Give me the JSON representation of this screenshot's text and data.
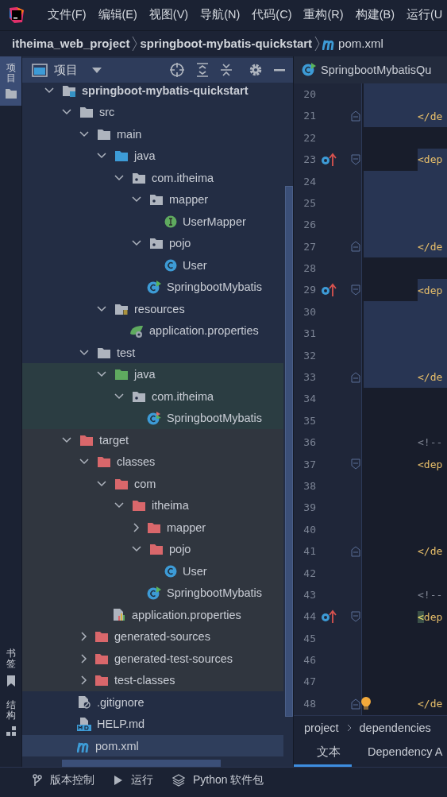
{
  "menu": [
    "文件(F)",
    "编辑(E)",
    "视图(V)",
    "导航(N)",
    "代码(C)",
    "重构(R)",
    "构建(B)",
    "运行(U"
  ],
  "breadcrumb": [
    {
      "label": "itheima_web_project",
      "kind": "folder"
    },
    {
      "label": "springboot-mybatis-quickstart",
      "kind": "folder"
    },
    {
      "label": "pom.xml",
      "kind": "maven"
    }
  ],
  "left_stripe": [
    {
      "label": "项目",
      "kind": "project",
      "selected": true
    },
    {
      "label": "书签",
      "kind": "bookmarks",
      "selected": false
    },
    {
      "label": "结构",
      "kind": "structure",
      "selected": false
    }
  ],
  "project_panel": {
    "title": "项目",
    "tree": [
      {
        "label": "springboot-mybatis-quickstart",
        "kind": "module",
        "expanded": true,
        "selected": false,
        "children": [
          {
            "label": "src",
            "kind": "folder",
            "expanded": true,
            "selected": false,
            "excluded": false,
            "children": [
              {
                "label": "main",
                "kind": "folder",
                "expanded": true,
                "selected": false,
                "children": [
                  {
                    "label": "java",
                    "kind": "source-folder",
                    "expanded": true,
                    "selected": false,
                    "test_sources": false,
                    "children": [
                      {
                        "label": "com.itheima",
                        "kind": "package",
                        "expanded": true,
                        "selected": false,
                        "children": [
                          {
                            "label": "mapper",
                            "kind": "package",
                            "expanded": true,
                            "selected": false,
                            "children": [
                              {
                                "label": "UserMapper",
                                "kind": "interface",
                                "selected": false
                              }
                            ]
                          },
                          {
                            "label": "pojo",
                            "kind": "package",
                            "expanded": true,
                            "selected": false,
                            "children": [
                              {
                                "label": "User",
                                "kind": "class",
                                "selected": false
                              }
                            ]
                          },
                          {
                            "label": "SpringbootMybatis",
                            "kind": "spring-class",
                            "selected": false
                          }
                        ]
                      }
                    ]
                  },
                  {
                    "label": "resources",
                    "kind": "resources",
                    "expanded": true,
                    "selected": false,
                    "children": [
                      {
                        "label": "application.properties",
                        "kind": "spring-properties",
                        "selected": false
                      }
                    ]
                  }
                ]
              },
              {
                "label": "test",
                "kind": "folder",
                "expanded": true,
                "selected": false,
                "children": [
                  {
                    "label": "java",
                    "kind": "test-folder",
                    "expanded": true,
                    "selected": false,
                    "test_sources": true,
                    "children": [
                      {
                        "label": "com.itheima",
                        "kind": "package",
                        "expanded": true,
                        "selected": false,
                        "children": [
                          {
                            "label": "SpringbootMybatis",
                            "kind": "spring-test-class",
                            "selected": false
                          }
                        ]
                      }
                    ]
                  }
                ]
              }
            ]
          },
          {
            "label": "target",
            "kind": "excluded-folder",
            "expanded": true,
            "selected": false,
            "excluded": true,
            "children": [
              {
                "label": "classes",
                "kind": "excluded-folder",
                "expanded": true,
                "selected": false,
                "children": [
                  {
                    "label": "com",
                    "kind": "excluded-folder",
                    "expanded": true,
                    "selected": false,
                    "children": [
                      {
                        "label": "itheima",
                        "kind": "excluded-folder",
                        "expanded": true,
                        "selected": false,
                        "children": [
                          {
                            "label": "mapper",
                            "kind": "excluded-folder",
                            "expanded": false,
                            "selected": false
                          },
                          {
                            "label": "pojo",
                            "kind": "excluded-folder",
                            "expanded": true,
                            "selected": false,
                            "children": [
                              {
                                "label": "User",
                                "kind": "class",
                                "selected": false
                              }
                            ]
                          },
                          {
                            "label": "SpringbootMybatis",
                            "kind": "spring-class",
                            "selected": false
                          }
                        ]
                      }
                    ]
                  },
                  {
                    "label": "application.properties",
                    "kind": "properties",
                    "selected": false
                  }
                ]
              },
              {
                "label": "generated-sources",
                "kind": "excluded-folder",
                "expanded": false,
                "selected": false
              },
              {
                "label": "generated-test-sources",
                "kind": "excluded-folder",
                "expanded": false,
                "selected": false
              },
              {
                "label": "test-classes",
                "kind": "excluded-folder",
                "expanded": false,
                "selected": false
              }
            ]
          },
          {
            "label": ".gitignore",
            "kind": "gitignore",
            "selected": false,
            "excluded": false
          },
          {
            "label": "HELP.md",
            "kind": "markdown",
            "selected": false,
            "excluded": false
          },
          {
            "label": "pom.xml",
            "kind": "maven",
            "selected": true,
            "excluded": false
          }
        ]
      }
    ]
  },
  "editor": {
    "tab": {
      "label": "SpringbootMybatisQu",
      "kind": "spring-class"
    },
    "lines": [
      {
        "number": "20",
        "highlight": true
      },
      {
        "number": "21",
        "code": "</de",
        "highlight": true,
        "fold_end": true
      },
      {
        "number": "22",
        "highlight": false
      },
      {
        "number": "23",
        "code": "<dep",
        "highlight": true,
        "fold_start": true,
        "override_marker": true
      },
      {
        "number": "24",
        "highlight": true
      },
      {
        "number": "25",
        "highlight": true
      },
      {
        "number": "26",
        "highlight": true
      },
      {
        "number": "27",
        "code": "</de",
        "highlight": true,
        "fold_end": true
      },
      {
        "number": "28",
        "highlight": false
      },
      {
        "number": "29",
        "code": "<dep",
        "highlight": true,
        "fold_start": true,
        "override_marker": true
      },
      {
        "number": "30",
        "highlight": true
      },
      {
        "number": "31",
        "highlight": true
      },
      {
        "number": "32",
        "highlight": true
      },
      {
        "number": "33",
        "code": "</de",
        "highlight": true,
        "fold_end": true
      },
      {
        "number": "34",
        "highlight": false
      },
      {
        "number": "35",
        "highlight": false
      },
      {
        "number": "36",
        "code": "<!--",
        "kind": "comment",
        "highlight": false
      },
      {
        "number": "37",
        "code": "<dep",
        "highlight": false,
        "fold_start": true
      },
      {
        "number": "38",
        "highlight": false
      },
      {
        "number": "39",
        "highlight": false
      },
      {
        "number": "40",
        "highlight": false
      },
      {
        "number": "41",
        "code": "</de",
        "highlight": false,
        "fold_end": true
      },
      {
        "number": "42",
        "highlight": false
      },
      {
        "number": "43",
        "code": "<!--",
        "kind": "comment",
        "highlight": false
      },
      {
        "number": "44",
        "code": "<dep",
        "highlight": false,
        "fold_start": true,
        "override_marker": true,
        "bracket_match": true
      },
      {
        "number": "45",
        "highlight": false
      },
      {
        "number": "46",
        "highlight": false
      },
      {
        "number": "47",
        "highlight": false
      },
      {
        "number": "48",
        "code": "</de",
        "highlight": false,
        "fold_end": true,
        "bulb": true,
        "current": true
      }
    ],
    "breadcrumb": [
      "project",
      "dependencies"
    ],
    "tabs": [
      {
        "label": "文本",
        "selected": true
      },
      {
        "label": "Dependency A",
        "selected": false
      }
    ]
  },
  "status_bar": [
    {
      "label": "版本控制",
      "kind": "vcs"
    },
    {
      "label": "运行",
      "kind": "run"
    },
    {
      "label": "Python 软件包",
      "kind": "packages"
    }
  ]
}
